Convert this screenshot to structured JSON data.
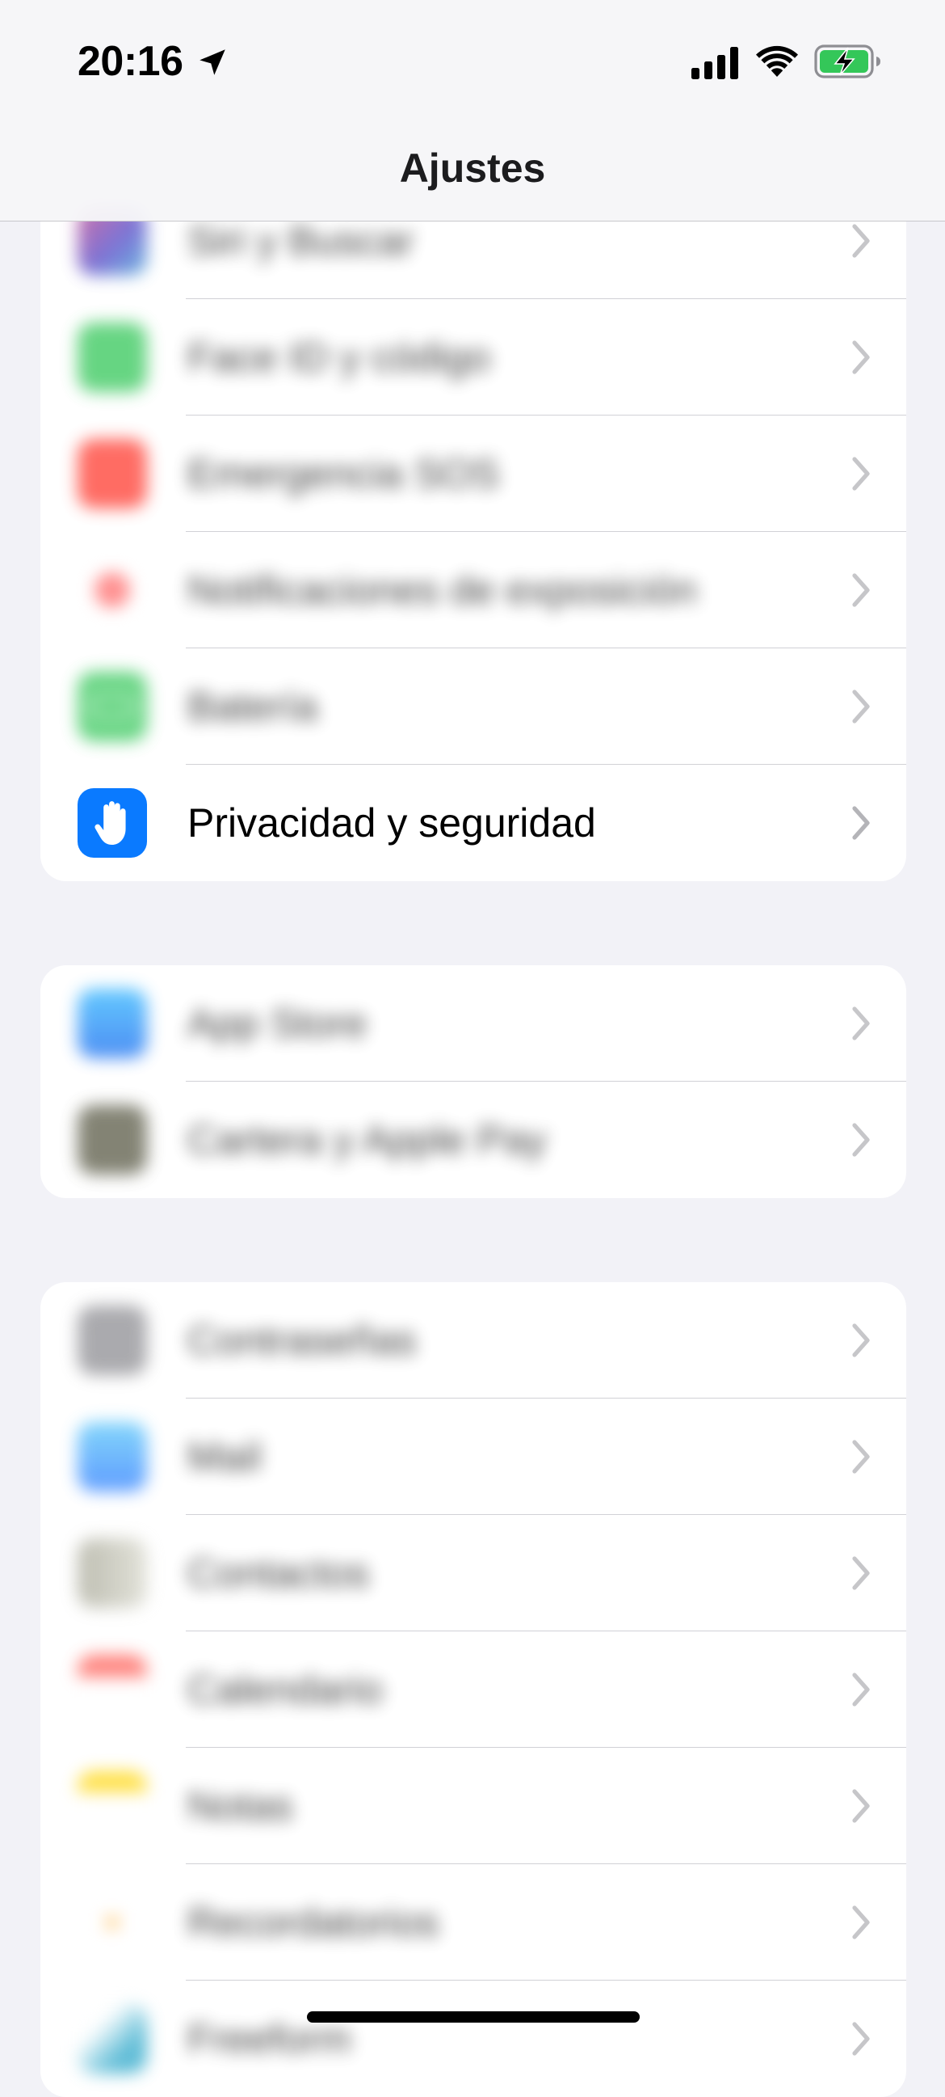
{
  "status_bar": {
    "time": "20:16",
    "location_icon": "location-arrow-icon",
    "signal_icon": "cellular-signal-icon",
    "wifi_icon": "wifi-icon",
    "battery_icon": "battery-charging-icon",
    "battery_color": "#34c759"
  },
  "nav": {
    "title": "Ajustes"
  },
  "groups": [
    {
      "items": [
        {
          "label": "Siri y Buscar",
          "icon": "siri-icon",
          "color": "#6b4fbb",
          "blurred": true
        },
        {
          "label": "Face ID y código",
          "icon": "face-id-icon",
          "color": "#34c759",
          "blurred": true
        },
        {
          "label": "Emergencia SOS",
          "icon": "sos-icon",
          "color": "#ff3b30",
          "blurred": true
        },
        {
          "label": "Notificaciones de exposición",
          "icon": "exposure-icon",
          "color": "#ff3b30",
          "blurred": true
        },
        {
          "label": "Batería",
          "icon": "battery-icon",
          "color": "#34c759",
          "blurred": true
        },
        {
          "label": "Privacidad y seguridad",
          "icon": "hand-icon",
          "color": "#0a7aff",
          "blurred": false
        }
      ]
    },
    {
      "items": [
        {
          "label": "App Store",
          "icon": "app-store-icon",
          "color": "#1e8cff",
          "blurred": true
        },
        {
          "label": "Cartera y Apple Pay",
          "icon": "wallet-icon",
          "color": "#5a5a46",
          "blurred": true
        }
      ]
    },
    {
      "items": [
        {
          "label": "Contraseñas",
          "icon": "key-icon",
          "color": "#8e8e93",
          "blurred": true
        },
        {
          "label": "Mail",
          "icon": "mail-icon",
          "color": "#3aa0ff",
          "blurred": true
        },
        {
          "label": "Contactos",
          "icon": "contacts-icon",
          "color": "#a8a898",
          "blurred": true
        },
        {
          "label": "Calendario",
          "icon": "calendar-icon",
          "color": "#ff5a52",
          "blurred": true
        },
        {
          "label": "Notas",
          "icon": "notes-icon",
          "color": "#ffd60a",
          "blurred": true
        },
        {
          "label": "Recordatorios",
          "icon": "reminders-icon",
          "color": "#ff9f0a",
          "blurred": true
        },
        {
          "label": "Freeform",
          "icon": "freeform-icon",
          "color": "#2aa6c9",
          "blurred": true
        }
      ]
    }
  ]
}
